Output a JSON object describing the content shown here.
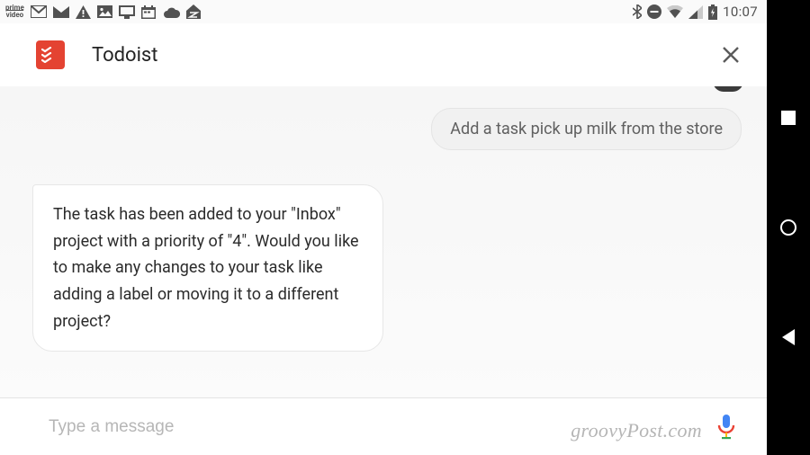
{
  "status_bar": {
    "clock": "10:07",
    "icons_left": [
      "prime-video-icon",
      "gmail-icon",
      "mail-icon",
      "warning-icon",
      "picture-icon",
      "display-icon",
      "calendar-icon",
      "cloud-icon",
      "zillow-icon"
    ],
    "icons_right": [
      "bluetooth-icon",
      "do-not-disturb-icon",
      "wifi-icon",
      "cell-signal-icon",
      "battery-charging-icon"
    ]
  },
  "header": {
    "title": "Todoist"
  },
  "conversation": {
    "outgoing": "Add a task pick up milk from the store",
    "incoming": "The task has been added to your \"Inbox\" project with a priority of \"4\". Would you like to make any changes to your task like adding a label or moving it to a different project?"
  },
  "input": {
    "placeholder": "Type a message"
  },
  "watermark": "groovyPost.com",
  "nav": {
    "recents": "recents",
    "home": "home",
    "back": "back"
  }
}
